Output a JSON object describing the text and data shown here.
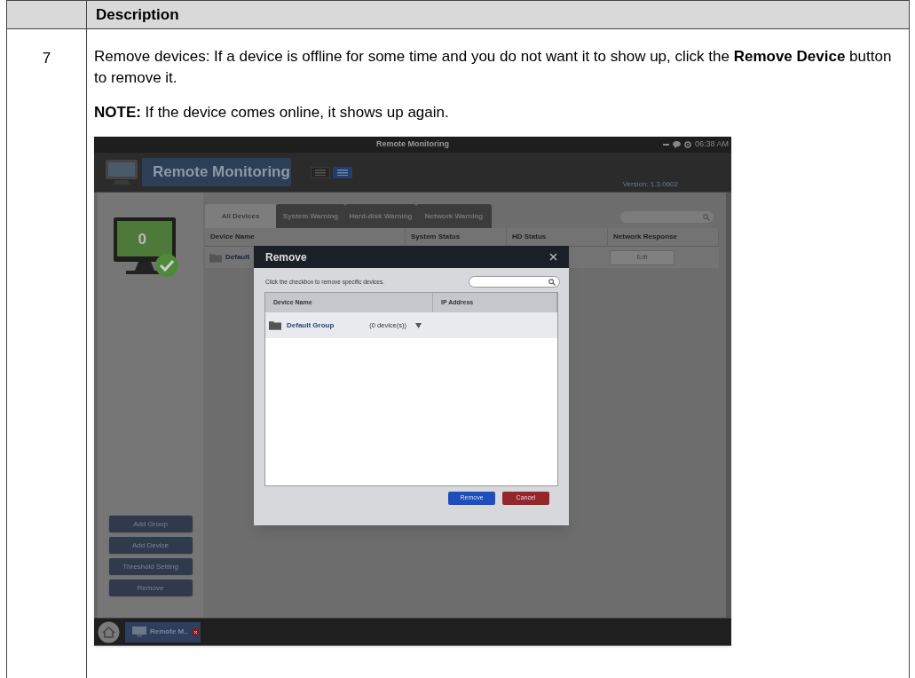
{
  "document_table": {
    "header": "Description",
    "rows": [
      {
        "step": "7",
        "paragraphs": [
          "Remove devices: If a device is offline for some time and you do not want it to show up, click the **Remove Device** button to remove it.",
          "**NOTE:** If the device comes online, it shows up again."
        ]
      }
    ]
  },
  "screenshot": {
    "window": {
      "title": "Remote Monitoring",
      "time": "06:38 AM"
    },
    "header": {
      "app_name": "Remote Monitoring",
      "view_buttons": [
        {
          "selected": false
        },
        {
          "selected": true
        }
      ],
      "version": "Version: 1.3.0602"
    },
    "device_count": "0",
    "sidebar_buttons": [
      "Add Group",
      "Add Device",
      "Threshold Setting",
      "Remove"
    ],
    "tabs": [
      {
        "label": "All Devices",
        "selected": true
      },
      {
        "label": "System Warning",
        "selected": false
      },
      {
        "label": "Hard-disk Warning",
        "selected": false
      },
      {
        "label": "Network Warning",
        "selected": false
      }
    ],
    "table": {
      "columns": [
        "Device Name",
        "System Status",
        "HD Status",
        "Network Response"
      ],
      "rows": [
        {
          "name": "Default",
          "action": "Edit"
        }
      ]
    },
    "dialog": {
      "title": "Remove",
      "instruction": "Click the checkbox to remove specific devices.",
      "columns": [
        "Device Name",
        "IP Address"
      ],
      "rows": [
        {
          "name": "Default Group",
          "count": "(0 device(s))",
          "selected": true
        }
      ],
      "buttons": [
        {
          "label": "Remove",
          "kind": "primary"
        },
        {
          "label": "Cancel",
          "kind": "cancel"
        }
      ]
    },
    "taskbar": {
      "items": [
        {
          "label": "Remote M.."
        }
      ]
    }
  }
}
